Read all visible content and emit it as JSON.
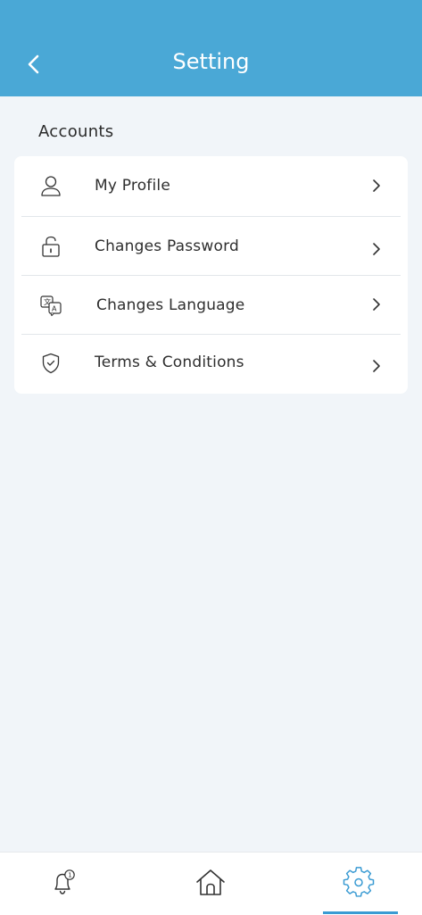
{
  "header": {
    "title": "Setting",
    "back_icon": "chevron-left-icon",
    "background": "#4aa8d6"
  },
  "accounts": {
    "section_title": "Accounts",
    "items": [
      {
        "label": "My Profile",
        "icon": "user-icon"
      },
      {
        "label": "Changes Password",
        "icon": "lock-icon"
      },
      {
        "label": "Changes Language",
        "icon": "translate-icon"
      },
      {
        "label": "Terms & Conditions",
        "icon": "shield-check-icon"
      }
    ]
  },
  "bottom_nav": {
    "items": [
      {
        "name": "notifications",
        "icon": "bell-icon",
        "badge": "1"
      },
      {
        "name": "home",
        "icon": "home-icon"
      },
      {
        "name": "settings",
        "icon": "gear-icon",
        "active": true
      }
    ],
    "active_color": "#3a9bd3"
  }
}
